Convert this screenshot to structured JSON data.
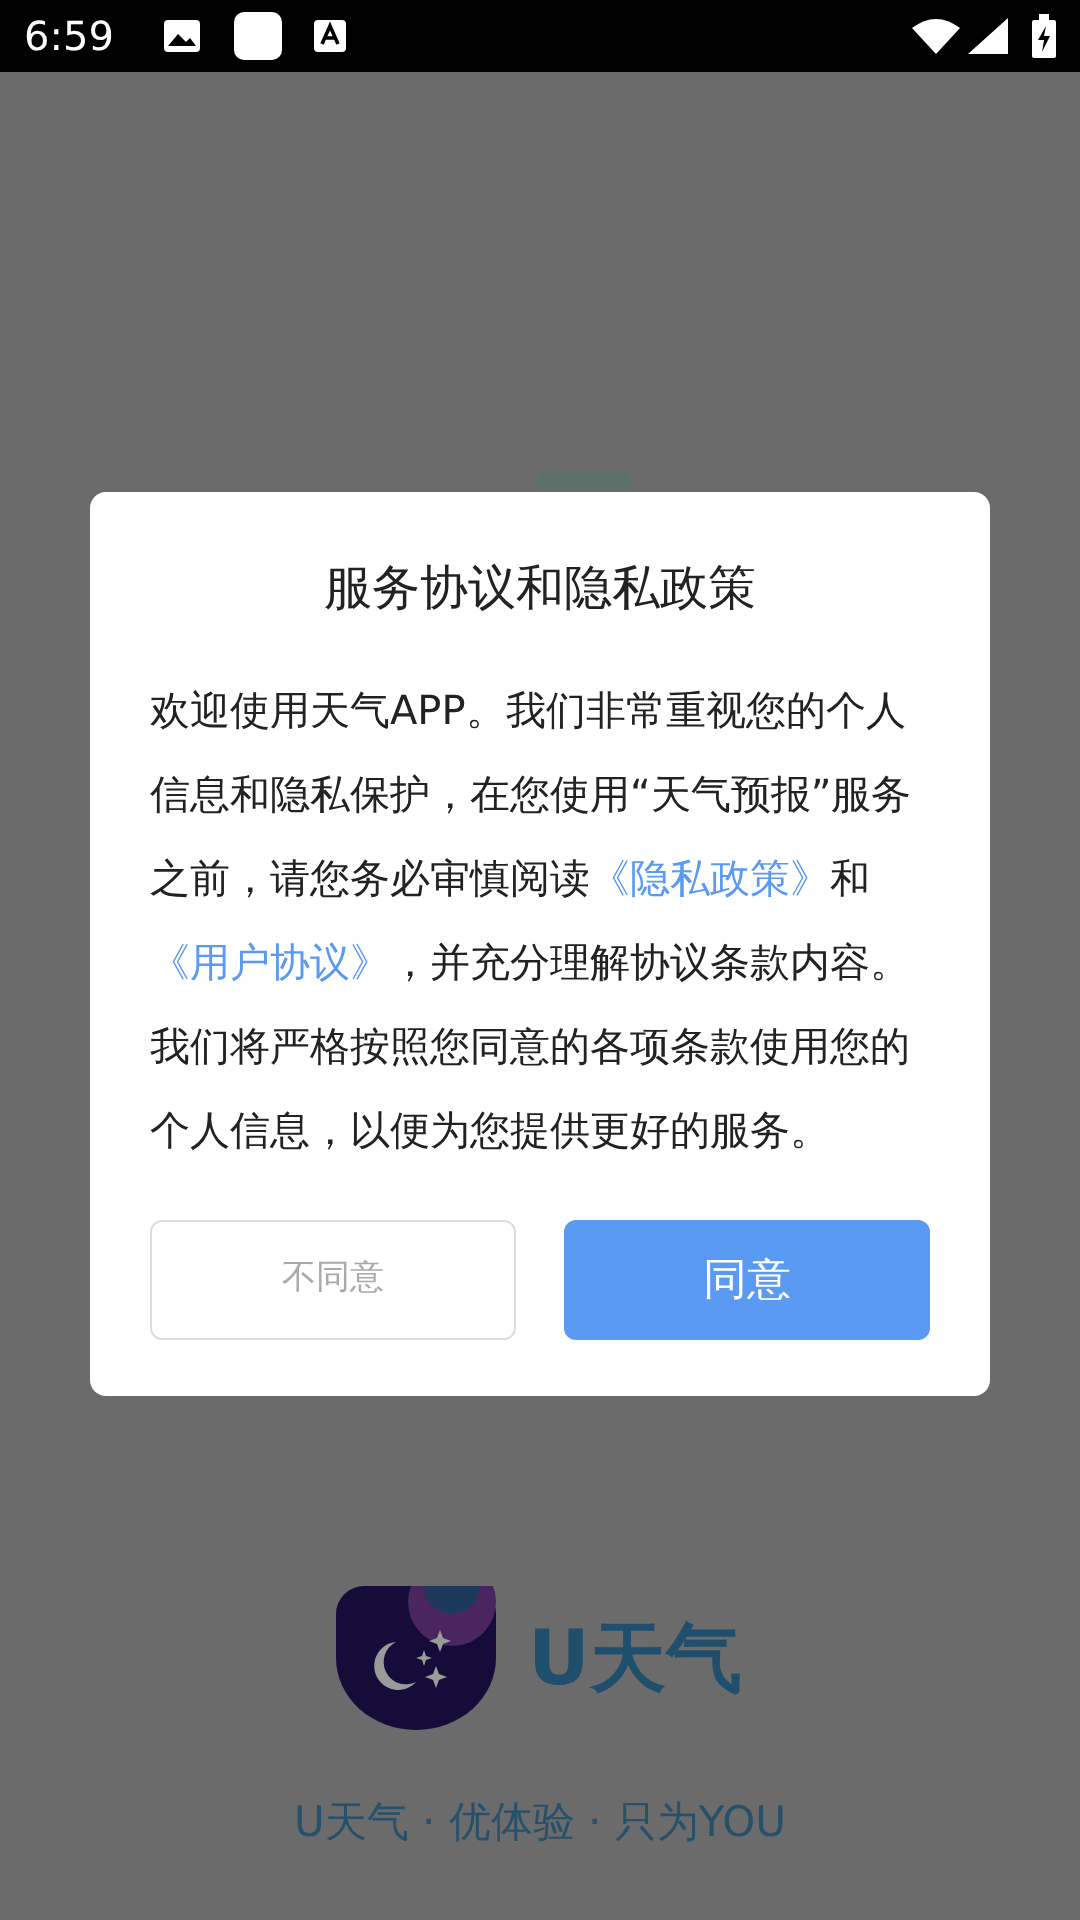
{
  "status_bar": {
    "time": "6:59"
  },
  "dialog": {
    "title": "服务协议和隐私政策",
    "body": [
      {
        "kind": "text",
        "text": "欢迎使用天气APP。我们非常重视您的个人信息和隐私保护，在您使用“天气预报”服务之前，请您务必审慎阅读"
      },
      {
        "kind": "link",
        "text": "《隐私政策》"
      },
      {
        "kind": "text",
        "text": "和"
      },
      {
        "kind": "link",
        "text": "《用户协议》"
      },
      {
        "kind": "text",
        "text": "，并充分理解协议条款内容。我们将严格按照您同意的各项条款使用您的个人信息，以便为您提供更好的服务。"
      }
    ],
    "buttons": [
      {
        "label": "不同意",
        "kind": "secondary"
      },
      {
        "label": "同意",
        "kind": "primary"
      }
    ]
  },
  "app": {
    "name": "U天气",
    "slogan": "U天气 · 优体验 · 只为YOU"
  }
}
